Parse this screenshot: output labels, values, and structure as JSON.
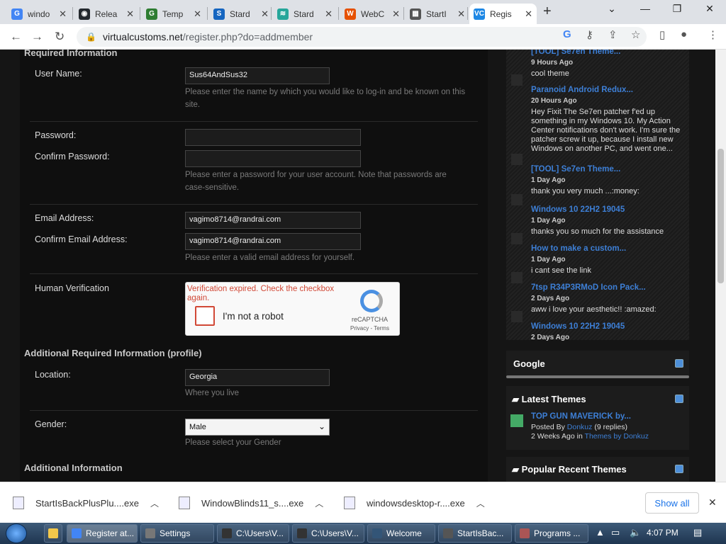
{
  "tabs": [
    {
      "title": "windo",
      "color": "#4285f4",
      "letter": "G"
    },
    {
      "title": "Relea",
      "color": "#24292e",
      "letter": "◉"
    },
    {
      "title": "Temp",
      "color": "#2e7d32",
      "letter": "G"
    },
    {
      "title": "Stard",
      "color": "#1565c0",
      "letter": "S"
    },
    {
      "title": "Stard",
      "color": "#26a69a",
      "letter": "≋"
    },
    {
      "title": "WebC",
      "color": "#e65100",
      "letter": "W"
    },
    {
      "title": "StartI",
      "color": "#555555",
      "letter": "▦"
    },
    {
      "title": "Regis",
      "color": "#1e88e5",
      "letter": "VC"
    }
  ],
  "url": {
    "host": "virtualcustoms.net",
    "path": "/register.php?do=addmember"
  },
  "form": {
    "section1": "Required Information",
    "username_label": "User Name:",
    "username_value": "Sus64AndSus32",
    "username_help": "Please enter the name by which you would like to log-in and be known on this site.",
    "password_label": "Password:",
    "confirm_password_label": "Confirm Password:",
    "password_help": "Please enter a password for your user account. Note that passwords are case-sensitive.",
    "email_label": "Email Address:",
    "email_value": "vagimo8714@randrai.com",
    "confirm_email_label": "Confirm Email Address:",
    "confirm_email_value": "vagimo8714@randrai.com",
    "email_help": "Please enter a valid email address for yourself.",
    "human_label": "Human Verification",
    "recaptcha": {
      "error": "Verification expired. Check the checkbox again.",
      "label": "I'm not a robot",
      "brand": "reCAPTCHA",
      "links": "Privacy - Terms"
    },
    "section2": "Additional Required Information (profile)",
    "location_label": "Location:",
    "location_value": "Georgia",
    "location_help": "Where you live",
    "gender_label": "Gender:",
    "gender_value": "Male",
    "gender_help": "Please select your Gender",
    "section3": "Additional Information"
  },
  "feed": [
    {
      "title": "[TOOL] Se7en Theme...",
      "date": "9 Hours Ago",
      "comment": "cool theme"
    },
    {
      "title": "Paranoid Android Redux...",
      "date": "20 Hours Ago",
      "comment": "Hey Fixit The Se7en patcher f'ed up something in my Windows 10. My Action Center notifications don't work. I'm sure the patcher screw it up, because I install new Windows on another PC, and went one..."
    },
    {
      "title": "[TOOL] Se7en Theme...",
      "date": "1 Day Ago",
      "comment": "thank you very much ...:money:"
    },
    {
      "title": "Windows 10 22H2 19045",
      "date": "1 Day Ago",
      "comment": "thanks you so much for the assistance"
    },
    {
      "title": "How to make a custom...",
      "date": "1 Day Ago",
      "comment": "i cant see the link"
    },
    {
      "title": "7tsp R34P3RMoD Icon Pack...",
      "date": "2 Days Ago",
      "comment": "aww i love your aesthetic!! :amazed:"
    },
    {
      "title": "Windows 10 22H2 19045",
      "date": "2 Days Ago",
      "comment": ""
    }
  ],
  "sidebar": {
    "google": "Google",
    "latest": "Latest Themes",
    "latest_item": {
      "title": "TOP GUN MAVERICK by...",
      "posted_by": "Posted By",
      "author": "Donkuz",
      "replies": "(9 replies)",
      "when": "2 Weeks Ago",
      "in": "in",
      "where": "Themes by Donkuz"
    },
    "popular": "Popular Recent Themes"
  },
  "downloads": [
    "StartIsBackPlusPlu....exe",
    "WindowBlinds11_s....exe",
    "windowsdesktop-r....exe"
  ],
  "show_all": "Show all",
  "taskbar": [
    "Register at...",
    "Settings",
    "C:\\Users\\V...",
    "C:\\Users\\V...",
    "Welcome",
    "StartIsBac...",
    "Programs ..."
  ],
  "clock": "4:07 PM"
}
